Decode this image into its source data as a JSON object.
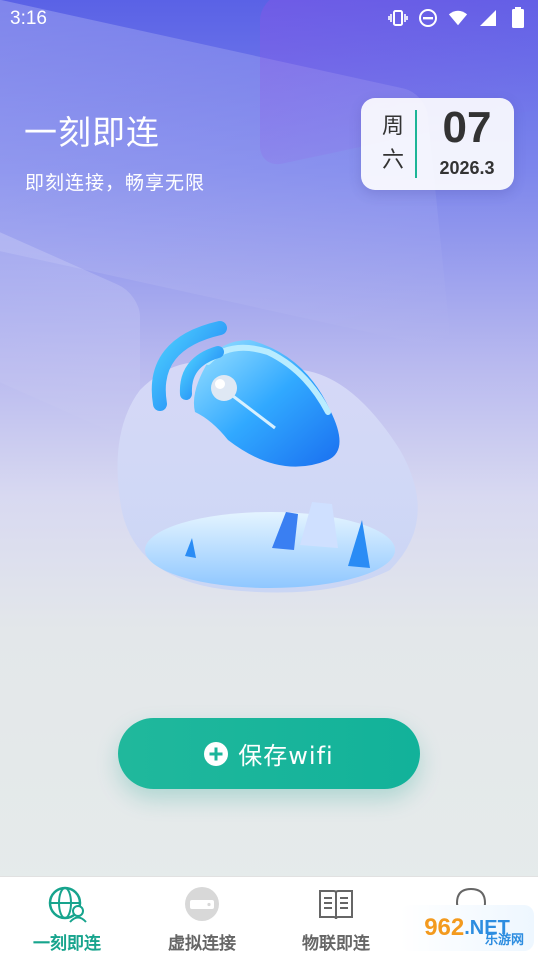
{
  "status_bar": {
    "time": "3:16"
  },
  "header": {
    "title": "一刻即连",
    "subtitle": "即刻连接，畅享无限"
  },
  "date_card": {
    "weekday_line1": "周",
    "weekday_line2": "六",
    "day": "07",
    "year_month": "2026.3"
  },
  "main": {
    "save_button_label": "保存wifi"
  },
  "tabs": [
    {
      "label": "一刻即连",
      "icon": "globe-user-icon",
      "active": true
    },
    {
      "label": "虚拟连接",
      "icon": "router-icon",
      "active": false
    },
    {
      "label": "物联即连",
      "icon": "book-icon",
      "active": false
    },
    {
      "label": "",
      "icon": "chat-robot-icon",
      "active": false
    }
  ],
  "watermark": {
    "text": "962",
    "suffix": ".NET",
    "sub": "乐游网"
  },
  "colors": {
    "accent": "#17a48d",
    "button": "#1bb59a",
    "header_top": "#5a62e6"
  }
}
